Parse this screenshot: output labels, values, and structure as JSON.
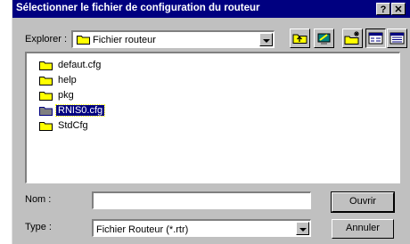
{
  "window": {
    "title": "Sélectionner le fichier de configuration du routeur",
    "help_label": "?",
    "close_label": "✕"
  },
  "lookin": {
    "label": "Explorer :",
    "value": "Fichier routeur"
  },
  "toolbar": {
    "icons": [
      "up-folder-icon",
      "desktop-icon",
      "new-folder-icon",
      "list-view-icon",
      "details-view-icon"
    ]
  },
  "files": [
    {
      "name": "defaut.cfg",
      "icon": "folder-icon",
      "selected": false
    },
    {
      "name": "help",
      "icon": "folder-icon",
      "selected": false
    },
    {
      "name": "pkg",
      "icon": "folder-icon",
      "selected": false
    },
    {
      "name": "RNIS0.cfg",
      "icon": "folder-icon",
      "selected": true
    },
    {
      "name": "StdCfg",
      "icon": "folder-icon",
      "selected": false
    }
  ],
  "filename": {
    "label": "Nom :",
    "value": ""
  },
  "filetype": {
    "label": "Type :",
    "value": "Fichier Routeur (*.rtr)"
  },
  "buttons": {
    "open": "Ouvrir",
    "cancel": "Annuler"
  },
  "colors": {
    "titlebar": "#000080",
    "face": "#c0c0c0",
    "folder": "#ffff00",
    "selection": "#000080"
  }
}
